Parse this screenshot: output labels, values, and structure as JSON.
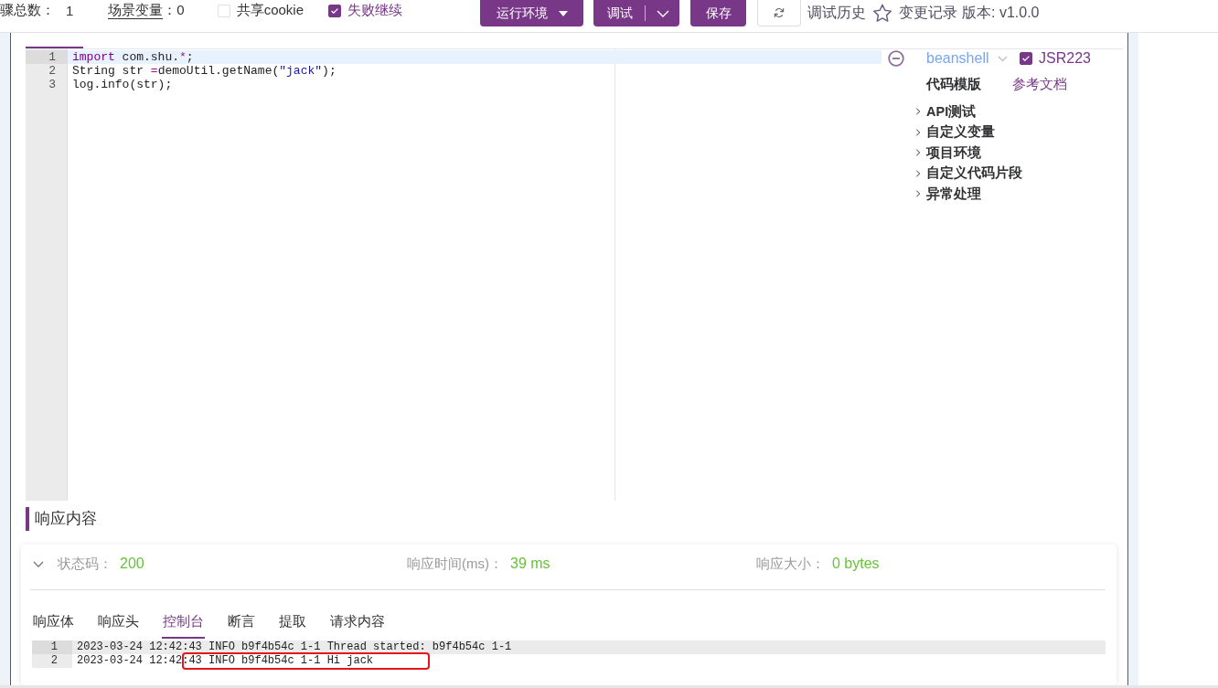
{
  "toolbar": {
    "step_count": {
      "label": "骤总数：",
      "value": "1"
    },
    "scene_variables": {
      "label": "场景变量",
      "value": "：0"
    },
    "options": [
      {
        "label": "共享cookie",
        "checked": false
      },
      {
        "label": "失败继续",
        "checked": true
      }
    ],
    "buttons": [
      {
        "kind": "dropdown",
        "label": "运行环境"
      },
      {
        "kind": "split",
        "label": "调试"
      },
      {
        "kind": "primary",
        "label": "保存"
      },
      {
        "kind": "refresh"
      }
    ],
    "debug_history": "调试历史",
    "change_log": "变更记录",
    "version": "版本: v1.0.0"
  },
  "script_editor": {
    "lines": [
      {
        "number": "1",
        "current": true,
        "tokens": [
          {
            "kind": "keyword",
            "text": "import"
          },
          {
            "kind": "plain",
            "text": " com.shu."
          },
          {
            "kind": "operator",
            "text": "*"
          },
          {
            "kind": "plain",
            "text": ";"
          }
        ]
      },
      {
        "number": "2",
        "current": false,
        "tokens": [
          {
            "kind": "plain",
            "text": "String str "
          },
          {
            "kind": "operator",
            "text": "="
          },
          {
            "kind": "plain",
            "text": "demoUtil.getName("
          },
          {
            "kind": "string",
            "text": "\"jack\""
          },
          {
            "kind": "plain",
            "text": ");"
          }
        ]
      },
      {
        "number": "3",
        "current": false,
        "tokens": [
          {
            "kind": "plain",
            "text": "log.info(str);"
          }
        ]
      }
    ]
  },
  "script_panel": {
    "language": "beanshell",
    "jsr223": {
      "label": "JSR223",
      "checked": true
    },
    "template_title": "代码模版",
    "docs_link": "参考文档",
    "template_items": [
      {
        "label": "API测试",
        "expanded": false
      },
      {
        "label": "自定义变量",
        "expanded": false
      },
      {
        "label": "项目环境",
        "expanded": false
      },
      {
        "label": "自定义代码片段",
        "expanded": false
      },
      {
        "label": "异常处理",
        "expanded": false
      }
    ]
  },
  "response": {
    "title": "响应内容",
    "metrics": [
      {
        "label": "状态码：",
        "value": "200"
      },
      {
        "label": "响应时间(ms)：",
        "value": "39 ms"
      },
      {
        "label": "响应大小：",
        "value": "0 bytes"
      }
    ],
    "tabs": [
      {
        "label": "响应体",
        "selected": false
      },
      {
        "label": "响应头",
        "selected": false
      },
      {
        "label": "控制台",
        "selected": true
      },
      {
        "label": "断言",
        "selected": false
      },
      {
        "label": "提取",
        "selected": false
      },
      {
        "label": "请求内容",
        "selected": false
      }
    ],
    "console": {
      "lines": [
        {
          "number": "1",
          "current": true,
          "annotated": false,
          "text": "2023-03-24 12:42:43 INFO b9f4b54c 1-1 Thread started: b9f4b54c 1-1"
        },
        {
          "number": "2",
          "current": false,
          "annotated": true,
          "text": "2023-03-24 12:42:43 INFO b9f4b54c 1-1 Hi jack"
        }
      ]
    }
  }
}
